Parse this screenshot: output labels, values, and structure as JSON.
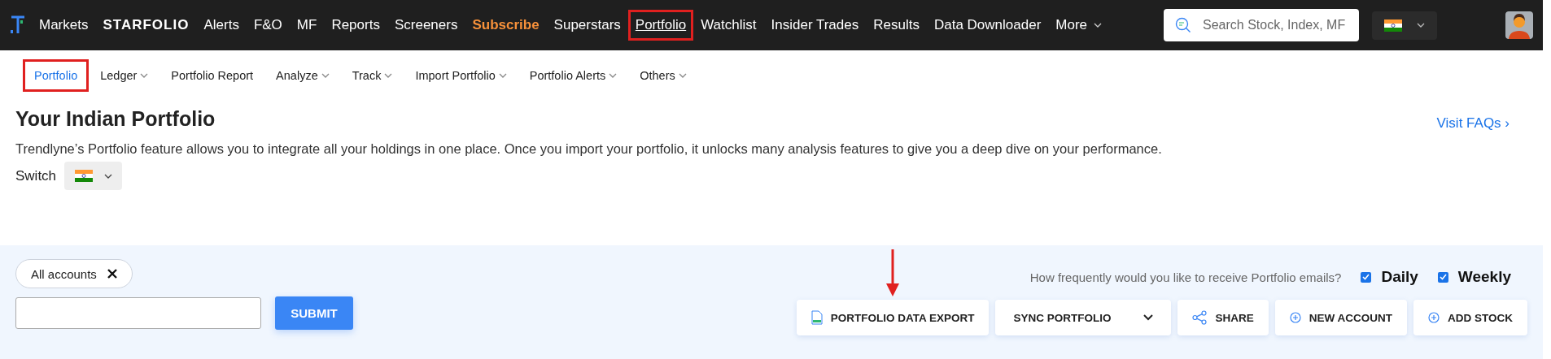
{
  "top_nav": {
    "items": [
      {
        "label": "Markets",
        "kind": "link",
        "selected": false,
        "highlighted": false
      },
      {
        "label": "STARFOLIO",
        "kind": "brand",
        "selected": false,
        "highlighted": false
      },
      {
        "label": "Alerts",
        "kind": "link",
        "selected": false,
        "highlighted": false
      },
      {
        "label": "F&O",
        "kind": "link",
        "selected": false,
        "highlighted": false
      },
      {
        "label": "MF",
        "kind": "link",
        "selected": false,
        "highlighted": false
      },
      {
        "label": "Reports",
        "kind": "link",
        "selected": false,
        "highlighted": false
      },
      {
        "label": "Screeners",
        "kind": "link",
        "selected": false,
        "highlighted": false
      },
      {
        "label": "Subscribe",
        "kind": "promo",
        "selected": false,
        "highlighted": false
      },
      {
        "label": "Superstars",
        "kind": "link",
        "selected": false,
        "highlighted": false
      },
      {
        "label": "Portfolio",
        "kind": "link",
        "selected": true,
        "highlighted": true
      },
      {
        "label": "Watchlist",
        "kind": "link",
        "selected": false,
        "highlighted": false
      },
      {
        "label": "Insider Trades",
        "kind": "link",
        "selected": false,
        "highlighted": false
      },
      {
        "label": "Results",
        "kind": "link",
        "selected": false,
        "highlighted": false
      },
      {
        "label": "Data Downloader",
        "kind": "link",
        "selected": false,
        "highlighted": false
      },
      {
        "label": "More",
        "kind": "dropdown",
        "selected": false,
        "highlighted": false
      }
    ],
    "search": {
      "placeholder": "Search Stock, Index, MF"
    }
  },
  "sub_nav": {
    "items": [
      {
        "label": "Portfolio",
        "dropdown": false,
        "selected": true,
        "highlighted": true
      },
      {
        "label": "Ledger",
        "dropdown": true,
        "selected": false,
        "highlighted": false
      },
      {
        "label": "Portfolio Report",
        "dropdown": false,
        "selected": false,
        "highlighted": false
      },
      {
        "label": "Analyze",
        "dropdown": true,
        "selected": false,
        "highlighted": false
      },
      {
        "label": "Track",
        "dropdown": true,
        "selected": false,
        "highlighted": false
      },
      {
        "label": "Import Portfolio",
        "dropdown": true,
        "selected": false,
        "highlighted": false
      },
      {
        "label": "Portfolio Alerts",
        "dropdown": true,
        "selected": false,
        "highlighted": false
      },
      {
        "label": "Others",
        "dropdown": true,
        "selected": false,
        "highlighted": false
      }
    ]
  },
  "header": {
    "title": "Your Indian Portfolio",
    "faq_link": "Visit FAQs ›",
    "description": "Trendlyne’s Portfolio feature allows you to integrate all your holdings in one place. Once you import your portfolio, it unlocks many analysis features to give you a deep dive on your performance.",
    "switch_label": "Switch"
  },
  "accounts": {
    "chip": "All accounts",
    "submit": "SUBMIT"
  },
  "emails": {
    "question": "How frequently would you like to receive Portfolio emails?",
    "options": [
      {
        "label": "Daily",
        "checked": true
      },
      {
        "label": "Weekly",
        "checked": true
      }
    ]
  },
  "actions": [
    {
      "label": "PORTFOLIO DATA EXPORT",
      "kind": "export",
      "pointed": true
    },
    {
      "label": "SYNC PORTFOLIO",
      "kind": "sync",
      "pointed": false
    },
    {
      "label": "SHARE",
      "kind": "share",
      "pointed": false
    },
    {
      "label": "NEW ACCOUNT",
      "kind": "add",
      "pointed": false
    },
    {
      "label": "ADD STOCK",
      "kind": "add",
      "pointed": false
    }
  ]
}
